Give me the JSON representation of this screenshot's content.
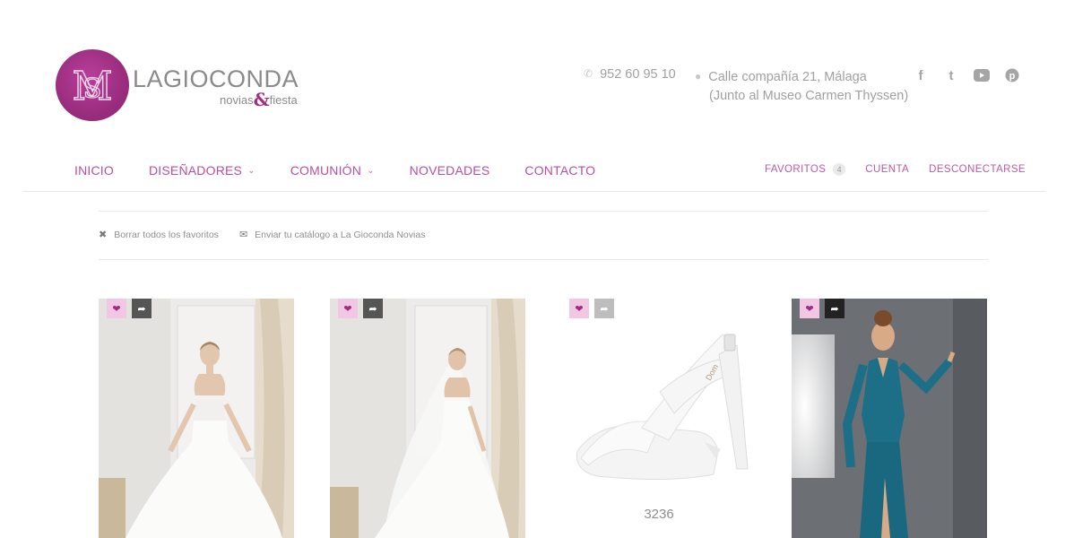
{
  "brand": {
    "name": "LAGIOCONDA",
    "tagline_left": "novias",
    "tagline_amp": "&",
    "tagline_right": "fiesta",
    "primary_color": "#a22d85"
  },
  "contact": {
    "phone": "952 60 95 10",
    "address_line1": "Calle compañía 21, Málaga",
    "address_line2": "(Junto al Museo Carmen Thyssen)"
  },
  "social": [
    {
      "icon": "facebook-icon",
      "glyph": "f"
    },
    {
      "icon": "twitter-icon",
      "glyph": "t"
    },
    {
      "icon": "youtube-icon",
      "glyph": "▶"
    },
    {
      "icon": "pinterest-icon",
      "glyph": "p"
    }
  ],
  "nav": {
    "items": [
      {
        "label": "INICIO",
        "has_menu": false
      },
      {
        "label": "DISEÑADORES",
        "has_menu": true
      },
      {
        "label": "COMUNIÓN",
        "has_menu": true
      },
      {
        "label": "NOVEDADES",
        "has_menu": false
      },
      {
        "label": "CONTACTO",
        "has_menu": false
      }
    ],
    "right": {
      "favorites": "FAVORITOS",
      "favorites_count": "4",
      "account": "CUENTA",
      "logout": "DESCONECTARSE"
    }
  },
  "actions": {
    "clear_favorites": "Borrar todos los favoritos",
    "send_catalog": "Enviar tu catálogo a La Gioconda Novias"
  },
  "products": [
    {
      "kind": "wedding-dress-strapless",
      "ref": ""
    },
    {
      "kind": "wedding-dress-veil",
      "ref": ""
    },
    {
      "kind": "bridal-sandal",
      "ref": "3236"
    },
    {
      "kind": "teal-lace-gown",
      "ref": ""
    }
  ]
}
